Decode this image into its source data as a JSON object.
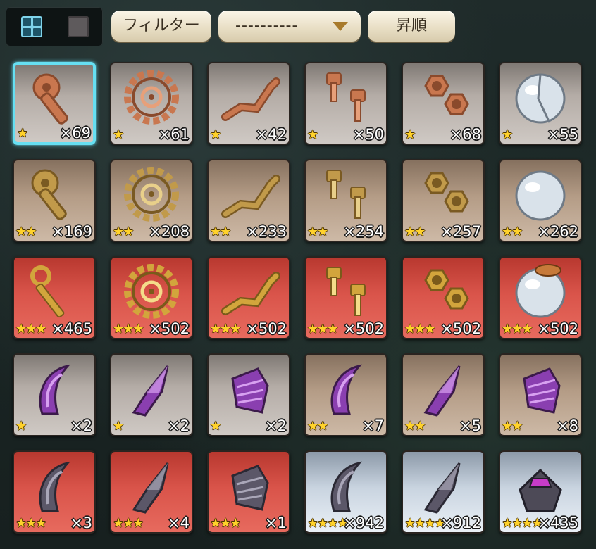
{
  "toolbar": {
    "filter_label": "フィルター",
    "select_value": "----------",
    "sort_label": "昇順"
  },
  "colors": {
    "accent_selected": "#66dff2",
    "star": "#ffd22b",
    "rarity1_bg": "#b4aca6",
    "rarity2_bg": "#b49c86",
    "rarity3_bg": "#d9544a",
    "rarity4_bg": "#c9d4e0"
  },
  "items": [
    {
      "icon": "copper-wrench-icon",
      "color": "gray",
      "stars": "★",
      "qty": "×69",
      "selected": true
    },
    {
      "icon": "copper-gear-icon",
      "color": "gray",
      "stars": "★",
      "qty": "×61"
    },
    {
      "icon": "copper-pipe-icon",
      "color": "gray",
      "stars": "★",
      "qty": "×42"
    },
    {
      "icon": "copper-bolts-icon",
      "color": "gray",
      "stars": "★",
      "qty": "×50"
    },
    {
      "icon": "copper-nuts-icon",
      "color": "gray",
      "stars": "★",
      "qty": "×68"
    },
    {
      "icon": "broken-glass-sphere-icon",
      "color": "gray",
      "stars": "★",
      "qty": "×55"
    },
    {
      "icon": "brass-wrench-icon",
      "color": "tan",
      "stars": "★★",
      "qty": "×169"
    },
    {
      "icon": "brass-gear-icon",
      "color": "tan",
      "stars": "★★",
      "qty": "×208"
    },
    {
      "icon": "brass-pipe-icon",
      "color": "tan",
      "stars": "★★",
      "qty": "×233"
    },
    {
      "icon": "brass-bolts-icon",
      "color": "tan",
      "stars": "★★",
      "qty": "×254"
    },
    {
      "icon": "brass-nuts-icon",
      "color": "tan",
      "stars": "★★",
      "qty": "×257"
    },
    {
      "icon": "glass-sphere-icon",
      "color": "tan",
      "stars": "★★",
      "qty": "×262"
    },
    {
      "icon": "golden-key-icon",
      "color": "red",
      "stars": "★★★",
      "qty": "×465"
    },
    {
      "icon": "golden-spiral-gear-icon",
      "color": "red",
      "stars": "★★★",
      "qty": "×502"
    },
    {
      "icon": "golden-faucet-pipe-icon",
      "color": "red",
      "stars": "★★★",
      "qty": "×502"
    },
    {
      "icon": "golden-bolt-icon",
      "color": "red",
      "stars": "★★★",
      "qty": "×502"
    },
    {
      "icon": "golden-clamp-nut-icon",
      "color": "red",
      "stars": "★★★",
      "qty": "×502"
    },
    {
      "icon": "capped-glass-sphere-icon",
      "color": "red",
      "stars": "★★★",
      "qty": "×502"
    },
    {
      "icon": "purple-claw-shard-icon",
      "color": "gray",
      "stars": "★",
      "qty": "×2"
    },
    {
      "icon": "purple-crystal-shard-icon",
      "color": "gray",
      "stars": "★",
      "qty": "×2"
    },
    {
      "icon": "purple-scale-shard-icon",
      "color": "gray",
      "stars": "★",
      "qty": "×2"
    },
    {
      "icon": "purple-claw-icon",
      "color": "tan",
      "stars": "★★",
      "qty": "×7"
    },
    {
      "icon": "purple-crystal-icon",
      "color": "tan",
      "stars": "★★",
      "qty": "×5"
    },
    {
      "icon": "purple-scale-icon",
      "color": "tan",
      "stars": "★★",
      "qty": "×8"
    },
    {
      "icon": "dark-claw-icon",
      "color": "red",
      "stars": "★★★",
      "qty": "×3"
    },
    {
      "icon": "dark-crystal-icon",
      "color": "red",
      "stars": "★★★",
      "qty": "×4"
    },
    {
      "icon": "dark-scale-icon",
      "color": "red",
      "stars": "★★★",
      "qty": "×1"
    },
    {
      "icon": "great-claw-icon",
      "color": "silver",
      "stars": "★★★★",
      "qty": "×942"
    },
    {
      "icon": "crystal-blade-icon",
      "color": "silver",
      "stars": "★★★★",
      "qty": "×912"
    },
    {
      "icon": "dark-altar-icon",
      "color": "silver",
      "stars": "★★★★",
      "qty": "×435"
    }
  ]
}
